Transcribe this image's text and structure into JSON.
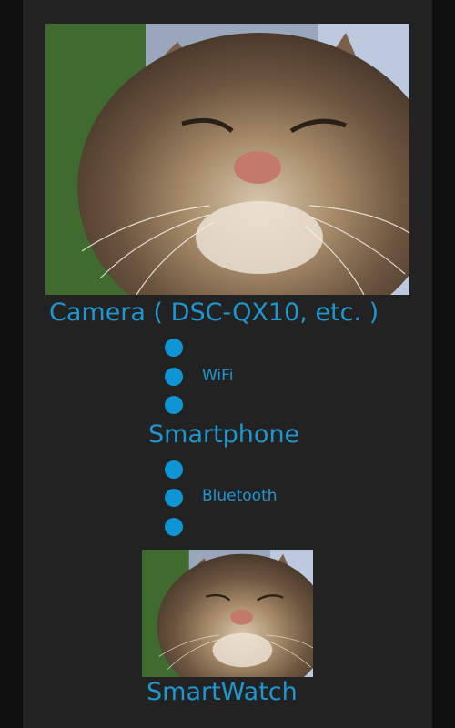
{
  "diagram": {
    "camera_label": "Camera ( DSC-QX10, etc. )",
    "link1_label": "WiFi",
    "smartphone_label": "Smartphone",
    "link2_label": "Bluetooth",
    "smartwatch_label": "SmartWatch"
  },
  "colors": {
    "background": "#222222",
    "outer": "#0f0f0f",
    "accent": "#1e96cf"
  }
}
